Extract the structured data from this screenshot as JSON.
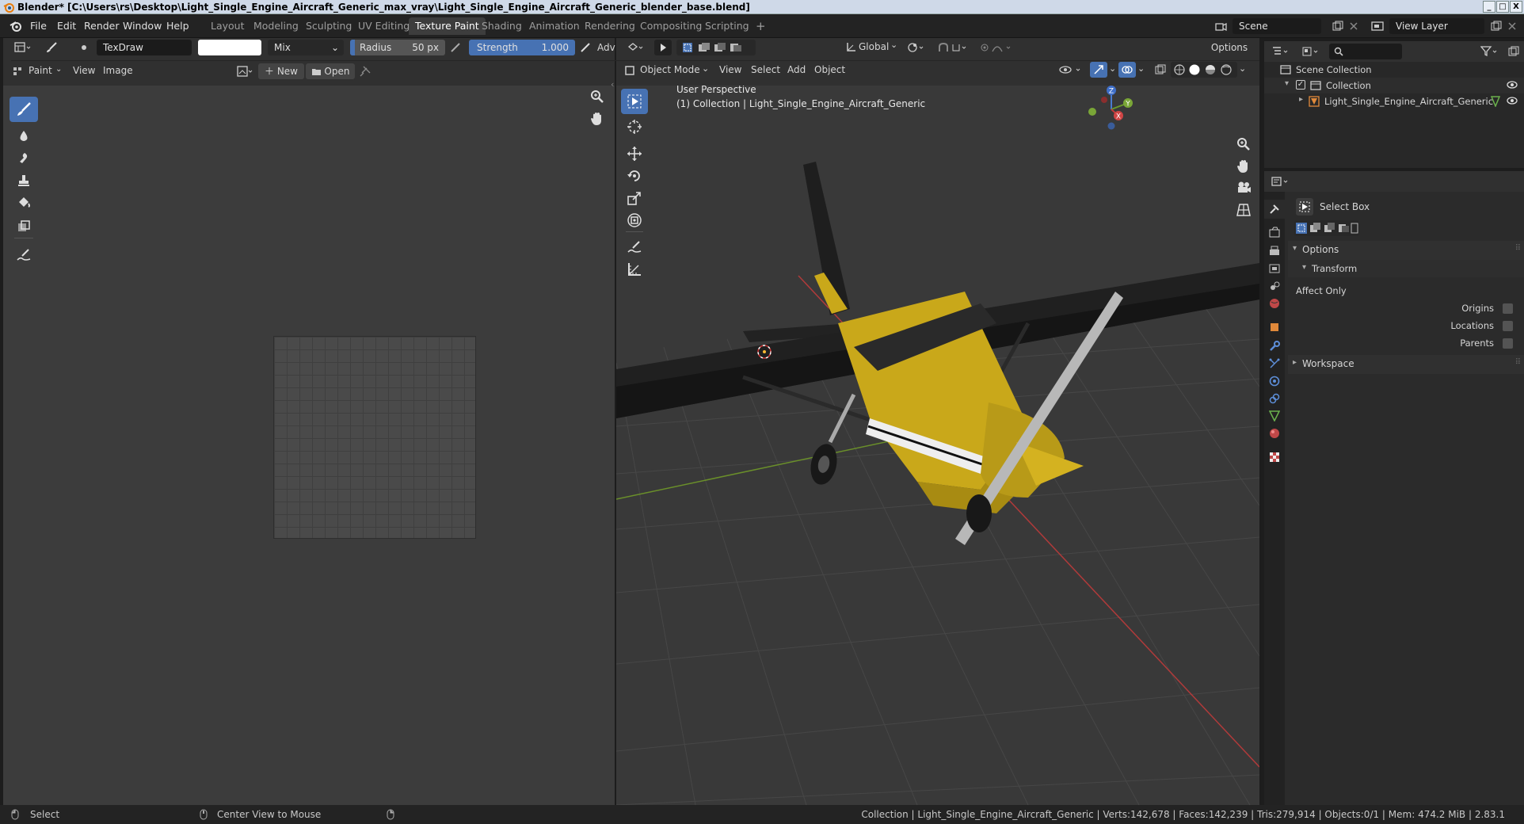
{
  "window": {
    "title": "Blender* [C:\\Users\\rs\\Desktop\\Light_Single_Engine_Aircraft_Generic_max_vray\\Light_Single_Engine_Aircraft_Generic_blender_base.blend]",
    "minimize": "_",
    "maximize": "□",
    "close": "X"
  },
  "menu": {
    "file": "File",
    "edit": "Edit",
    "render": "Render",
    "window": "Window",
    "help": "Help"
  },
  "workspaces": [
    "Layout",
    "Modeling",
    "Sculpting",
    "UV Editing",
    "Texture Paint",
    "Shading",
    "Animation",
    "Rendering",
    "Compositing",
    "Scripting"
  ],
  "workspace_add": "+",
  "scene": {
    "name": "Scene",
    "view_layer": "View Layer"
  },
  "brush": {
    "name": "TexDraw",
    "color": "#ffffff",
    "blend": "Mix",
    "radius_label": "Radius",
    "radius_value": "50 px",
    "strength_label": "Strength",
    "strength_value": "1.000",
    "advanced": "Adv"
  },
  "image_editor": {
    "mode": "Paint",
    "view": "View",
    "image": "Image",
    "new": "New",
    "open": "Open"
  },
  "viewport": {
    "transform_orientation": "Global",
    "options": "Options",
    "mode": "Object Mode",
    "menus": [
      "View",
      "Select",
      "Add",
      "Object"
    ],
    "overlay_title": "User Perspective",
    "overlay_subtitle": "(1) Collection | Light_Single_Engine_Aircraft_Generic",
    "gizmo": {
      "x": "X",
      "y": "Y",
      "z": "Z"
    }
  },
  "outliner": {
    "scene_collection": "Scene Collection",
    "collection": "Collection",
    "object": "Light_Single_Engine_Aircraft_Generic"
  },
  "properties": {
    "tool": "Select Box",
    "options": "Options",
    "transform": "Transform",
    "affect_only": "Affect Only",
    "origins": "Origins",
    "locations": "Locations",
    "parents": "Parents",
    "workspace": "Workspace"
  },
  "status": {
    "left": "Select",
    "middle": "Center View to Mouse",
    "stats": "Collection | Light_Single_Engine_Aircraft_Generic | Verts:142,678 | Faces:142,239 | Tris:279,914 | Objects:0/1 | Mem: 474.2 MiB | 2.83.1"
  },
  "colors": {
    "accent": "#4772b3",
    "plane_yellow": "#c9a81a",
    "axis_red": "#b03a3a",
    "axis_green": "#6a8f2a"
  }
}
